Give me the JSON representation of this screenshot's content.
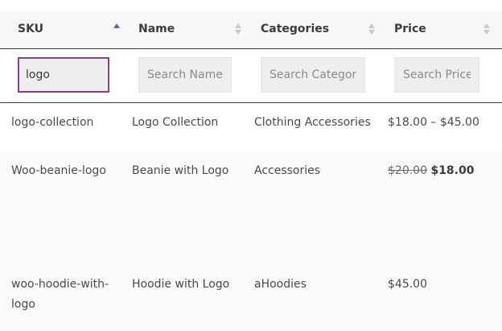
{
  "table": {
    "columns": [
      {
        "label": "SKU",
        "sort": "asc"
      },
      {
        "label": "Name",
        "sort": "none"
      },
      {
        "label": "Categories",
        "sort": "none"
      },
      {
        "label": "Price",
        "sort": "none"
      }
    ],
    "filters": {
      "sku": {
        "value": "logo",
        "placeholder": ""
      },
      "name": {
        "value": "",
        "placeholder": "Search Name"
      },
      "categories": {
        "value": "",
        "placeholder": "Search Categories"
      },
      "price": {
        "value": "",
        "placeholder": "Search Price"
      }
    },
    "rows": [
      {
        "sku": "logo-collection",
        "name": "Logo Collection",
        "categories": "Clothing Accessories",
        "price": "$18.00 – $45.00"
      },
      {
        "sku": "Woo-beanie-logo",
        "name": "Beanie with Logo",
        "categories": "Accessories",
        "price_old": "$20.00",
        "price_new": "$18.00"
      },
      {
        "sku": "woo-hoodie-with-logo",
        "name": "Hoodie with Logo",
        "categories": "aHoodies",
        "price": "$45.00"
      }
    ]
  },
  "colors": {
    "accent": "#7f54b3",
    "focus_border": "#8c3e88",
    "header_bg": "#f7f7f7",
    "input_bg": "#eeeeee"
  },
  "icons": {
    "sort_active": "sort-ascending-icon",
    "sort_inactive": "sort-unsorted-icon"
  }
}
